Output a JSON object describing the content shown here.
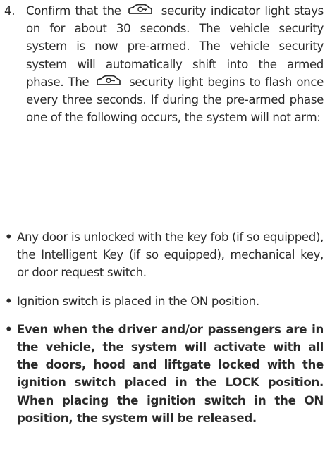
{
  "step": {
    "number": "4.",
    "part1": "Confirm that the",
    "part2": "security indicator light stays on for about 30 seconds. The vehicle security system is now pre-armed. The vehicle security system will automatically shift into the armed phase. The",
    "part3": "security light begins to flash once every three seconds. If during the pre-armed phase one of the following occurs, the system will not arm:",
    "icon_name": "vehicle-security-icon"
  },
  "bullets": [
    {
      "marker": "•",
      "text": "Any door is unlocked with the key fob (if so equipped), the Intelligent Key (if so equipped), mechanical key, or door request switch."
    },
    {
      "marker": "•",
      "text": "Ignition switch is placed in the ON position."
    },
    {
      "marker": "•",
      "text": "Even when the driver and/or passengers are in the vehicle, the system will activate with all the doors, hood and liftgate locked with the ignition switch placed in the LOCK position. When placing the ignition switch in the ON position, the system will be released."
    }
  ]
}
